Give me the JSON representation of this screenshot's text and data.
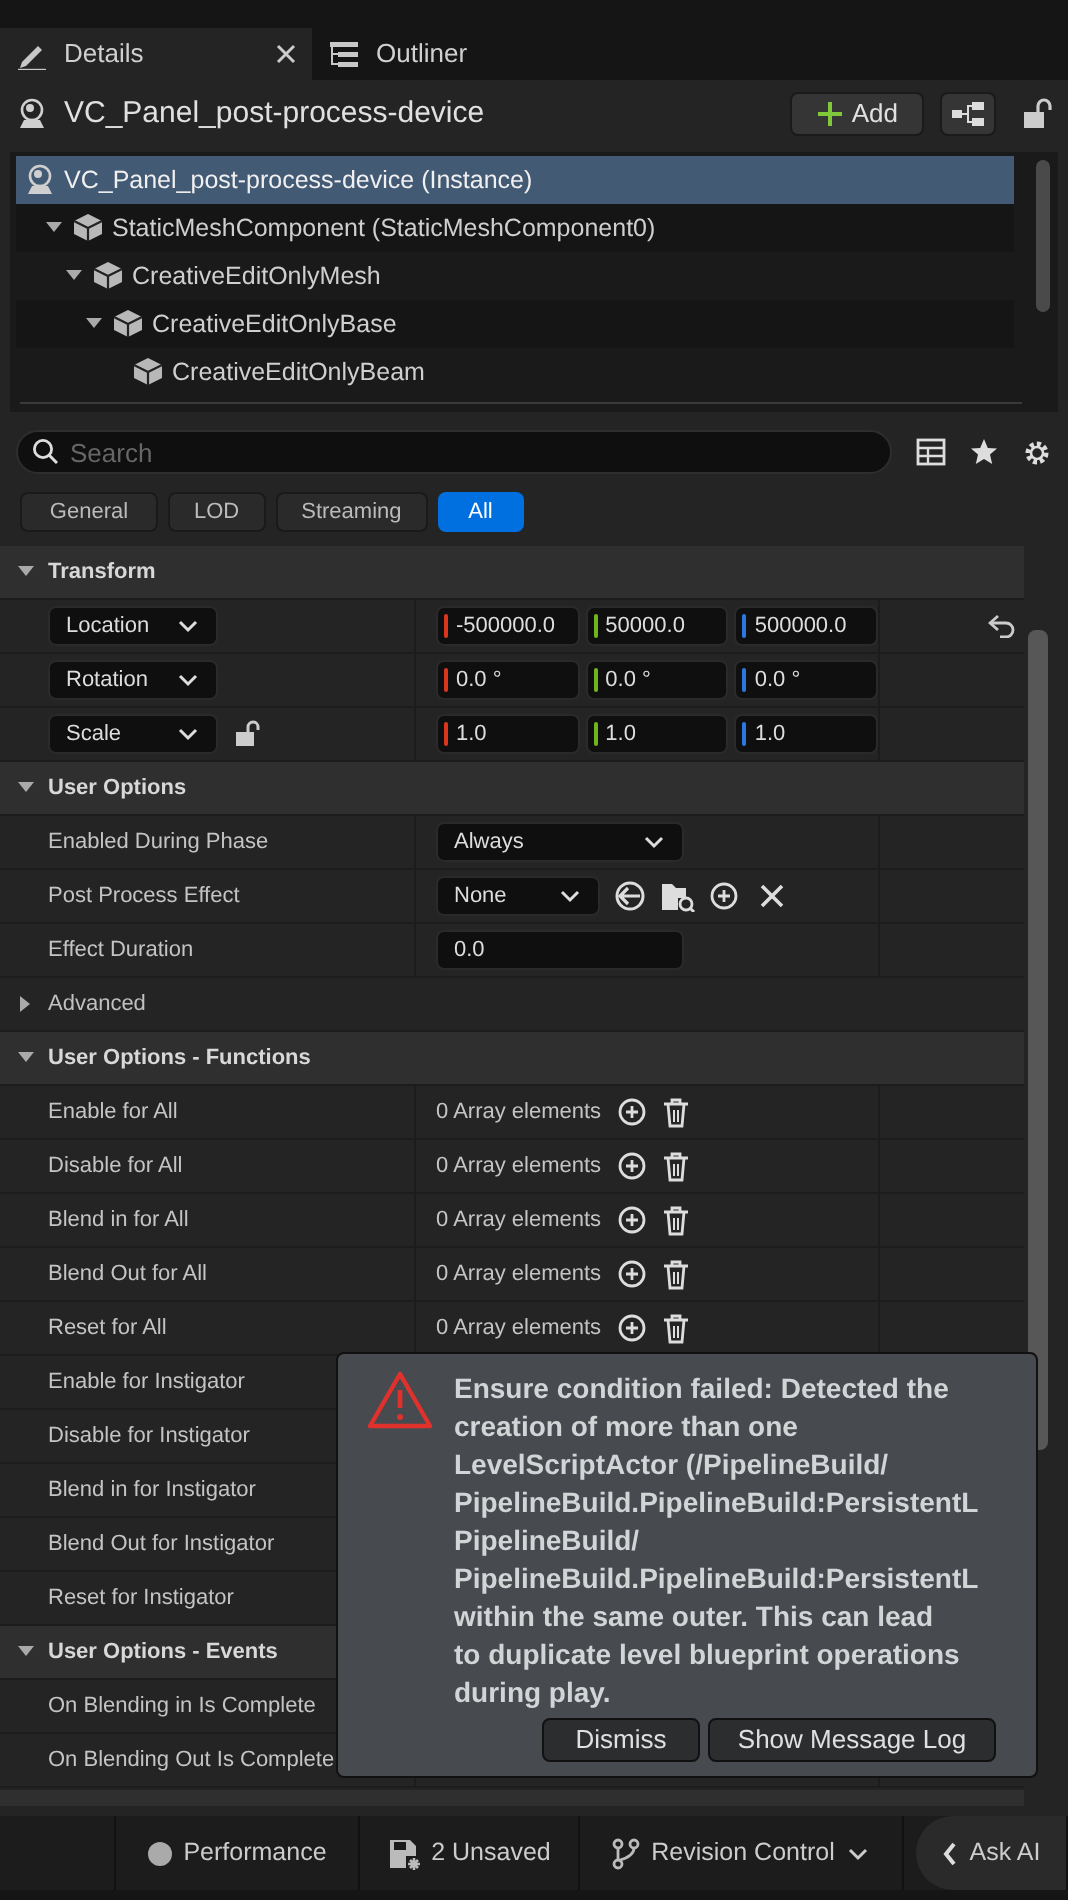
{
  "tabs": [
    {
      "label": "Details",
      "selected": true
    },
    {
      "label": "Outliner",
      "selected": false
    }
  ],
  "header": {
    "title": "VC_Panel_post-process-device",
    "add_button": "Add"
  },
  "tree": [
    {
      "label": "VC_Panel_post-process-device (Instance)",
      "kind": "actor",
      "selected": true,
      "children": [
        {
          "label": "StaticMeshComponent (StaticMeshComponent0)",
          "kind": "mesh",
          "selected": false,
          "expanded": true,
          "children": [
            {
              "label": "CreativeEditOnlyMesh",
              "kind": "mesh",
              "selected": false,
              "expanded": true,
              "children": [
                {
                  "label": "CreativeEditOnlyBase",
                  "kind": "mesh",
                  "selected": false,
                  "expanded": true,
                  "children": [
                    {
                      "label": "CreativeEditOnlyBeam",
                      "kind": "mesh",
                      "selected": false
                    }
                  ]
                }
              ]
            }
          ]
        }
      ]
    }
  ],
  "search": {
    "placeholder": "Search"
  },
  "filters": [
    {
      "label": "General",
      "selected": false
    },
    {
      "label": "LOD",
      "selected": false
    },
    {
      "label": "Streaming",
      "selected": false
    },
    {
      "label": "All",
      "selected": true
    }
  ],
  "sections": [
    {
      "title": "Transform",
      "expanded": true,
      "rows": [
        {
          "kind": "vector",
          "label": "Location",
          "values": [
            "-500000.0",
            "50000.0",
            "500000.0"
          ],
          "resettable": true,
          "lockable": false
        },
        {
          "kind": "vector",
          "label": "Rotation",
          "values": [
            "0.0 °",
            "0.0 °",
            "0.0 °"
          ],
          "resettable": false,
          "lockable": false
        },
        {
          "kind": "vector",
          "label": "Scale",
          "values": [
            "1.0",
            "1.0",
            "1.0"
          ],
          "resettable": false,
          "lockable": true
        }
      ]
    },
    {
      "title": "User Options",
      "expanded": true,
      "rows": [
        {
          "kind": "dropdown",
          "label": "Enabled During Phase",
          "value": "Always"
        },
        {
          "kind": "asset",
          "label": "Post Process Effect",
          "value": "None"
        },
        {
          "kind": "number",
          "label": "Effect Duration",
          "value": "0.0"
        },
        {
          "kind": "group",
          "label": "Advanced",
          "expanded": false
        }
      ]
    },
    {
      "title": "User Options - Functions",
      "expanded": true,
      "rows": [
        {
          "kind": "array",
          "label": "Enable for All",
          "value": "0 Array elements"
        },
        {
          "kind": "array",
          "label": "Disable for All",
          "value": "0 Array elements"
        },
        {
          "kind": "array",
          "label": "Blend in for All",
          "value": "0 Array elements"
        },
        {
          "kind": "array",
          "label": "Blend Out for All",
          "value": "0 Array elements"
        },
        {
          "kind": "array",
          "label": "Reset for All",
          "value": "0 Array elements"
        },
        {
          "kind": "array",
          "label": "Enable for Instigator"
        },
        {
          "kind": "array",
          "label": "Disable for Instigator"
        },
        {
          "kind": "array",
          "label": "Blend in for Instigator"
        },
        {
          "kind": "array",
          "label": "Blend Out for Instigator"
        },
        {
          "kind": "array",
          "label": "Reset for Instigator"
        }
      ]
    },
    {
      "title": "User Options - Events",
      "expanded": true,
      "rows": [
        {
          "kind": "event",
          "label": "On Blending in Is Complete"
        },
        {
          "kind": "event",
          "label": "On Blending Out Is Complete"
        }
      ]
    }
  ],
  "toast": {
    "message_lines": [
      "Ensure condition failed: Detected the",
      "creation of more than one",
      "LevelScriptActor (/PipelineBuild/",
      "PipelineBuild.PipelineBuild:PersistentL",
      "PipelineBuild/",
      "PipelineBuild.PipelineBuild:PersistentL",
      "within the same outer. This can lead",
      "to duplicate level blueprint operations",
      "during play."
    ],
    "buttons": [
      "Dismiss",
      "Show Message Log"
    ]
  },
  "status_bar": [
    {
      "kind": "performance",
      "label": "Performance"
    },
    {
      "kind": "unsaved",
      "label": "2 Unsaved"
    },
    {
      "kind": "revision",
      "label": "Revision Control"
    },
    {
      "kind": "ai",
      "label": "Ask AI"
    }
  ]
}
